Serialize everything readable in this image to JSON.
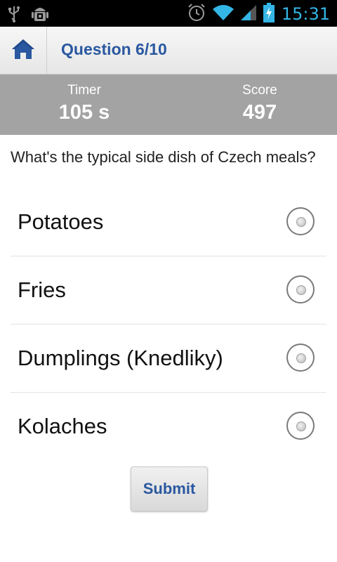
{
  "status_bar": {
    "time": "15:31",
    "icons": [
      "usb-icon",
      "android-debug-icon",
      "alarm-icon",
      "wifi-icon",
      "signal-icon",
      "battery-charging-icon"
    ]
  },
  "app_bar": {
    "home_icon": "home-icon",
    "title": "Question 6/10"
  },
  "stats": {
    "timer_label": "Timer",
    "timer_value": "105 s",
    "score_label": "Score",
    "score_value": "497"
  },
  "question": {
    "text": "What's the typical side dish of Czech meals?",
    "options": [
      {
        "label": "Potatoes"
      },
      {
        "label": "Fries"
      },
      {
        "label": "Dumplings (Knedliky)"
      },
      {
        "label": "Kolaches"
      }
    ]
  },
  "submit_label": "Submit",
  "colors": {
    "accent": "#2a58a0",
    "stats_bg": "#a3a3a3",
    "status_icons": "#33b5e5"
  }
}
